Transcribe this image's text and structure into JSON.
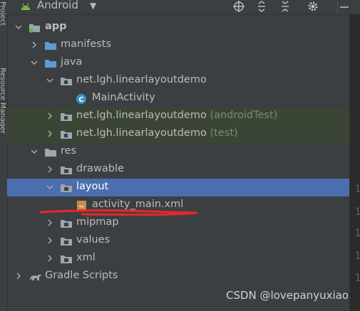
{
  "sidebar": {
    "label_top": "Project",
    "label_bottom": "Resource Manager"
  },
  "toolbar": {
    "title": "Android"
  },
  "tree": [
    {
      "label": "app",
      "bold": true,
      "depth": 0,
      "arrow": "down",
      "icon": "module-folder-icon"
    },
    {
      "label": "manifests",
      "depth": 1,
      "arrow": "right",
      "icon": "folder-blue-icon"
    },
    {
      "label": "java",
      "depth": 1,
      "arrow": "down",
      "icon": "folder-blue-icon"
    },
    {
      "label": "net.lgh.linearlayoutdemo",
      "depth": 2,
      "arrow": "down",
      "icon": "package-icon"
    },
    {
      "label": "MainActivity",
      "depth": 3,
      "arrow": "",
      "icon": "class-icon"
    },
    {
      "label": "net.lgh.linearlayoutdemo",
      "suffix": "(androidTest)",
      "depth": 2,
      "arrow": "right",
      "icon": "package-icon",
      "highlight": true
    },
    {
      "label": "net.lgh.linearlayoutdemo",
      "suffix": "(test)",
      "depth": 2,
      "arrow": "right",
      "icon": "package-icon",
      "highlight": true
    },
    {
      "label": "res",
      "depth": 1,
      "arrow": "down",
      "icon": "res-folder-icon"
    },
    {
      "label": "drawable",
      "depth": 2,
      "arrow": "right",
      "icon": "folder-gray-icon"
    },
    {
      "label": "layout",
      "depth": 2,
      "arrow": "down",
      "icon": "folder-gray-icon",
      "selected": true
    },
    {
      "label": "activity_main.xml",
      "depth": 3,
      "arrow": "",
      "icon": "xml-file-icon"
    },
    {
      "label": "mipmap",
      "depth": 2,
      "arrow": "right",
      "icon": "folder-gray-icon"
    },
    {
      "label": "values",
      "depth": 2,
      "arrow": "right",
      "icon": "folder-gray-icon"
    },
    {
      "label": "xml",
      "depth": 2,
      "arrow": "right",
      "icon": "folder-gray-icon"
    },
    {
      "label": "Gradle Scripts",
      "depth": 0,
      "arrow": "right",
      "icon": "gradle-icon"
    }
  ],
  "editor_gutter": [
    "1",
    "1",
    "1",
    "1",
    "1"
  ],
  "watermark": "CSDN @lovepanyuxiao",
  "colors": {
    "background": "#3c3f41",
    "selected": "#4b6eaf",
    "highlight": "#3b4535",
    "annotation": "#e8262a"
  }
}
